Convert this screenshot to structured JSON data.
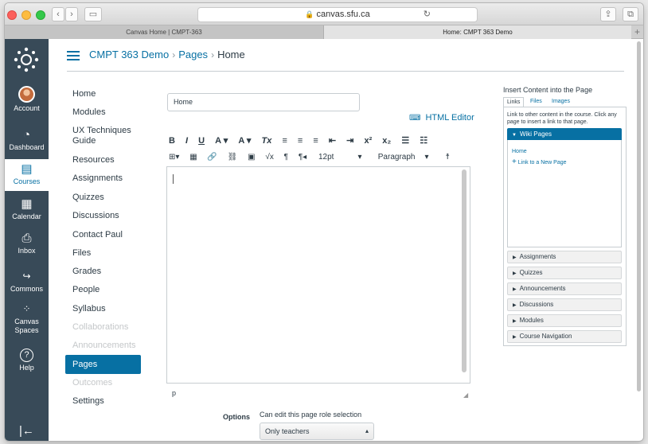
{
  "browser": {
    "url": "canvas.sfu.ca",
    "tabs": [
      {
        "label": "Canvas Home | CMPT-363"
      },
      {
        "label": "Home: CMPT 363 Demo"
      }
    ],
    "new_tab": "+"
  },
  "global_nav": {
    "items": [
      {
        "label": "Account",
        "icon": "account-avatar"
      },
      {
        "label": "Dashboard",
        "icon": "dashboard-icon"
      },
      {
        "label": "Courses",
        "icon": "courses-icon"
      },
      {
        "label": "Calendar",
        "icon": "calendar-icon"
      },
      {
        "label": "Inbox",
        "icon": "inbox-icon"
      },
      {
        "label": "Commons",
        "icon": "commons-icon"
      },
      {
        "label": "Canvas Spaces",
        "icon": "spaces-icon"
      },
      {
        "label": "Help",
        "icon": "help-icon"
      }
    ],
    "active": "Courses",
    "collapse_glyph": "|←"
  },
  "breadcrumb": {
    "course": "CMPT 363 Demo",
    "section": "Pages",
    "current": "Home",
    "separator": "›"
  },
  "course_nav": {
    "items": [
      {
        "label": "Home",
        "state": "normal"
      },
      {
        "label": "Modules",
        "state": "normal"
      },
      {
        "label": "UX Techniques",
        "label2": "Guide",
        "state": "normal"
      },
      {
        "label": "Resources",
        "state": "normal"
      },
      {
        "label": "Assignments",
        "state": "normal"
      },
      {
        "label": "Quizzes",
        "state": "normal"
      },
      {
        "label": "Discussions",
        "state": "normal"
      },
      {
        "label": "Contact Paul",
        "state": "normal"
      },
      {
        "label": "Files",
        "state": "normal"
      },
      {
        "label": "Grades",
        "state": "normal"
      },
      {
        "label": "People",
        "state": "normal"
      },
      {
        "label": "Syllabus",
        "state": "normal"
      },
      {
        "label": "Collaborations",
        "state": "disabled"
      },
      {
        "label": "Announcements",
        "state": "disabled"
      },
      {
        "label": "Pages",
        "state": "active"
      },
      {
        "label": "Outcomes",
        "state": "disabled"
      },
      {
        "label": "Settings",
        "state": "normal"
      }
    ]
  },
  "editor": {
    "title_value": "Home",
    "html_editor_label": "HTML Editor",
    "toolbar_row1": [
      "B",
      "I",
      "U",
      "A ▾",
      "A ▾",
      "Tx",
      "≡",
      "≡",
      "≡",
      "⇤",
      "⇥",
      "x²",
      "x₂",
      "☰",
      "☷"
    ],
    "toolbar_row2": [
      "⊞▾",
      "▦",
      "🔗",
      "⛓",
      "▣",
      "√x",
      "¶",
      "¶◂"
    ],
    "font_size": "12pt",
    "block_format": "Paragraph",
    "status_path": "p"
  },
  "options": {
    "label": "Options",
    "role_text": "Can edit this page role selection",
    "role_value": "Only teachers"
  },
  "insert_panel": {
    "title": "Insert Content into the Page",
    "tabs": [
      "Links",
      "Files",
      "Images"
    ],
    "active_tab": "Links",
    "description": "Link to other content in the course. Click any page to insert a link to that page.",
    "open_section": "Wiki Pages",
    "wiki_links": [
      "Home",
      "Link to a New Page"
    ],
    "sections": [
      "Assignments",
      "Quizzes",
      "Announcements",
      "Discussions",
      "Modules",
      "Course Navigation"
    ]
  },
  "colors": {
    "canvas_blue": "#0770a3",
    "nav_bg": "#384a58"
  }
}
